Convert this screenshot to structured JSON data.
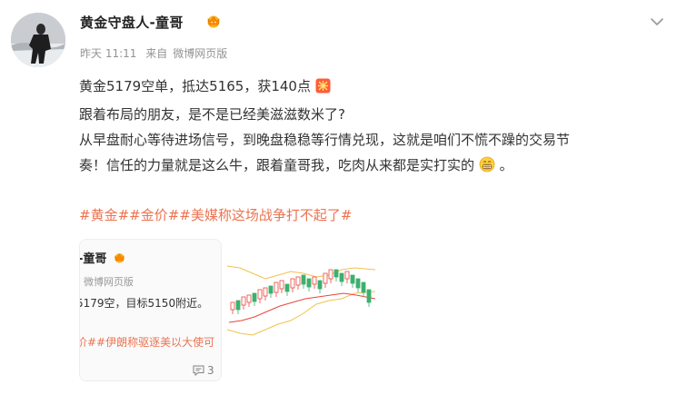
{
  "post": {
    "author": "黄金守盘人-童哥",
    "time": "昨天 11:11",
    "source_prefix": "来自",
    "source": "微博网页版",
    "lines": [
      "黄金5179空单，抵达5165，获140点",
      "跟着布局的朋友，是不是已经美滋滋数米了?",
      "从早盘耐心等待进场信号，到晚盘稳稳等行情兑现，这就是咱们不慌不躁的交易节",
      "奏！信任的力量就是这么牛，跟着童哥我，吃肉从来都是实打实的"
    ],
    "tags": [
      "#黄金#",
      "#金价#",
      "#美媒称这场战争打不起了#"
    ]
  },
  "repost_card": {
    "author": "-童哥",
    "meta": "微博网页版",
    "text": "5179空，目标5150附近。",
    "tags": "价##伊朗称驱逐美以大使可",
    "comment_count": "3"
  },
  "icons": {
    "crown": "crown-badge-icon",
    "more": "chevron-down-icon",
    "celebrate": "celebrate-emoji-icon",
    "grin": "grin-emoji-icon",
    "comment": "comment-icon"
  },
  "colors": {
    "tag": "#eb7350",
    "meta": "#939393",
    "candle_up": "#e8463c",
    "candle_down": "#3db06e",
    "band": "#f2c14e",
    "ma_red": "#e8463c"
  }
}
